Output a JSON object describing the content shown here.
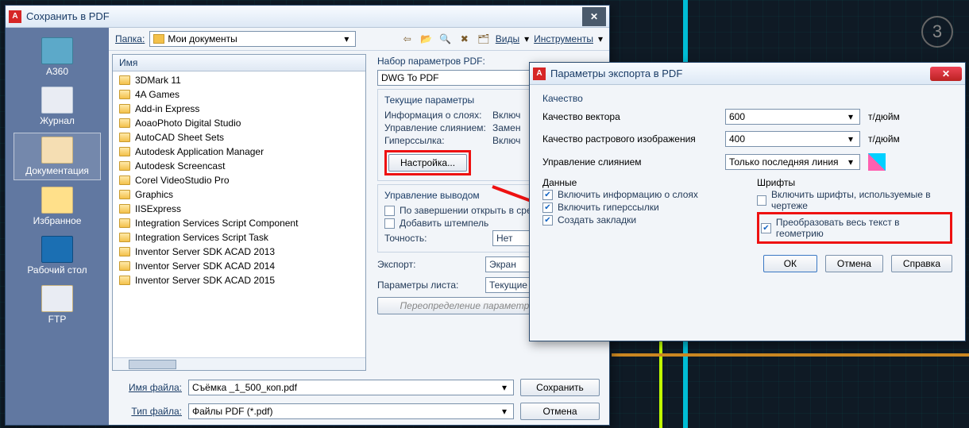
{
  "cad": {
    "counter": "3"
  },
  "dlg1": {
    "title": "Сохранить в PDF",
    "folder_label": "Папка:",
    "folder_value": "Мои документы",
    "views": "Виды",
    "tools": "Инструменты",
    "places": [
      "A360",
      "Журнал",
      "Документация",
      "Избранное",
      "Рабочий стол",
      "FTP"
    ],
    "col_name": "Имя",
    "files": [
      "3DMark 11",
      "4A Games",
      "Add-in Express",
      "AoaoPhoto Digital Studio",
      "AutoCAD Sheet Sets",
      "Autodesk Application Manager",
      "Autodesk Screencast",
      "Corel VideoStudio Pro",
      "Graphics",
      "IISExpress",
      "Integration Services Script Component",
      "Integration Services Script Task",
      "Inventor Server SDK ACAD 2013",
      "Inventor Server SDK ACAD 2014",
      "Inventor Server SDK ACAD 2015"
    ],
    "pdf": {
      "set_label": "Набор параметров PDF:",
      "set_value": "DWG To PDF",
      "current": "Текущие параметры",
      "layers_k": "Информация о слоях:",
      "layers_v": "Включ",
      "merge_k": "Управление слиянием:",
      "merge_v": "Замен",
      "hyper_k": "Гиперссылка:",
      "hyper_v": "Включ",
      "settings_btn": "Настройка...",
      "output": "Управление выводом",
      "open_after": "По завершении открыть в сред",
      "stamp": "Добавить штемпель",
      "precision_k": "Точность:",
      "precision_v": "Нет",
      "export_k": "Экспорт:",
      "export_v": "Экран",
      "pageset_k": "Параметры листа:",
      "pageset_v": "Текущие",
      "override": "Переопределение параметров листа..."
    },
    "fname_label": "Имя файла:",
    "fname_value": "Съёмка _1_500_коп.pdf",
    "ftype_label": "Тип файла:",
    "ftype_value": "Файлы PDF (*.pdf)",
    "save": "Сохранить",
    "cancel": "Отмена"
  },
  "dlg2": {
    "title": "Параметры экспорта в PDF",
    "quality": "Качество",
    "vec_k": "Качество вектора",
    "vec_v": "600",
    "unit": "т/дюйм",
    "ras_k": "Качество растрового изображения",
    "ras_v": "400",
    "merge_k": "Управление слиянием",
    "merge_v": "Только последняя линия",
    "data": "Данные",
    "inc_layers": "Включить информацию о слоях",
    "inc_hyper": "Включить гиперссылки",
    "inc_bm": "Создать закладки",
    "fonts": "Шрифты",
    "inc_fonts": "Включить шрифты, используемые в чертеже",
    "to_geom": "Преобразовать весь текст в геометрию",
    "ok": "ОК",
    "cancel": "Отмена",
    "help": "Справка"
  }
}
